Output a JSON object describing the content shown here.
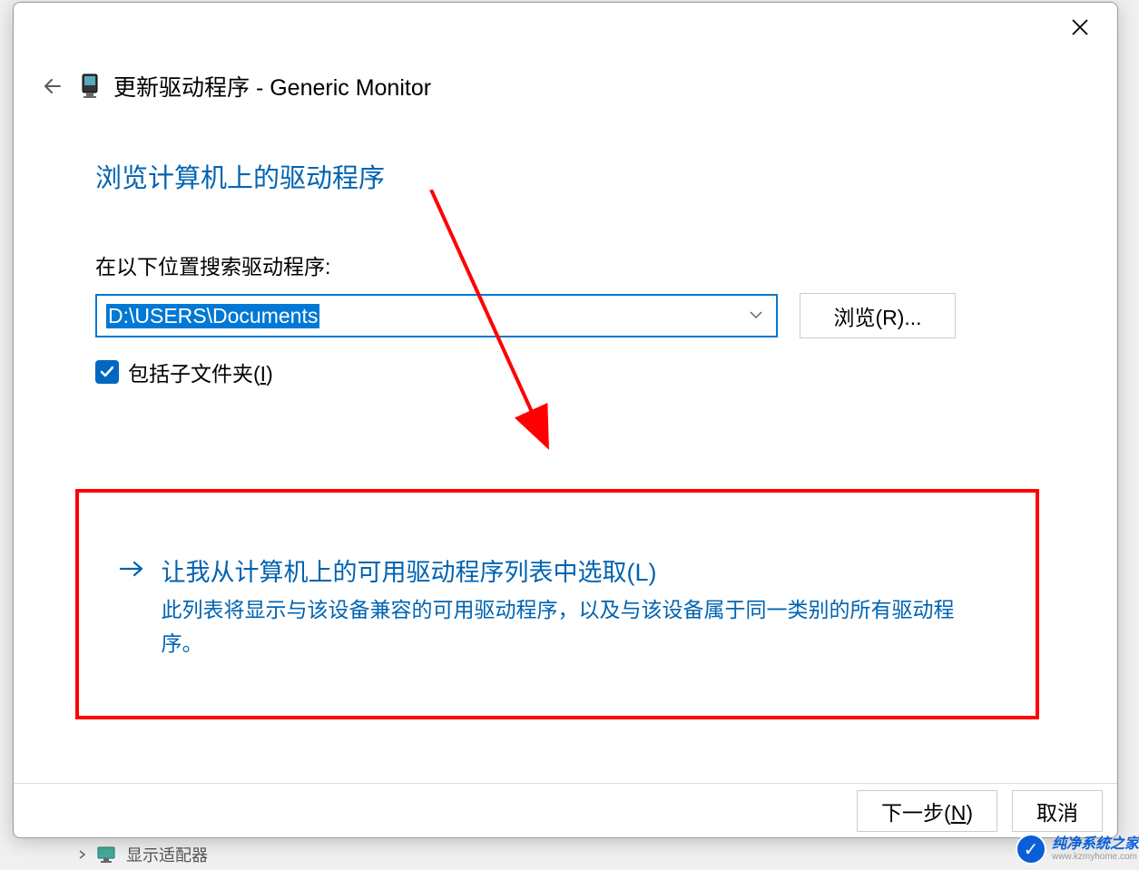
{
  "dialog": {
    "title": "更新驱动程序 - Generic Monitor",
    "section_title": "浏览计算机上的驱动程序",
    "search_label": "在以下位置搜索驱动程序:",
    "path_value": "D:\\USERS\\Documents",
    "browse_label": "浏览(R)...",
    "checkbox_label_prefix": "包括子文件夹(",
    "checkbox_label_key": "I",
    "checkbox_label_suffix": ")",
    "checkbox_checked": true,
    "option_title": "让我从计算机上的可用驱动程序列表中选取(L)",
    "option_desc": "此列表将显示与该设备兼容的可用驱动程序，以及与该设备属于同一类别的所有驱动程序。",
    "next_label_prefix": "下一步(",
    "next_label_key": "N",
    "next_label_suffix": ")",
    "cancel_label": "取消"
  },
  "background": {
    "tree_item": "显示适配器"
  },
  "watermark": {
    "title": "纯净系统之家",
    "url": "www.kzmyhome.com"
  }
}
